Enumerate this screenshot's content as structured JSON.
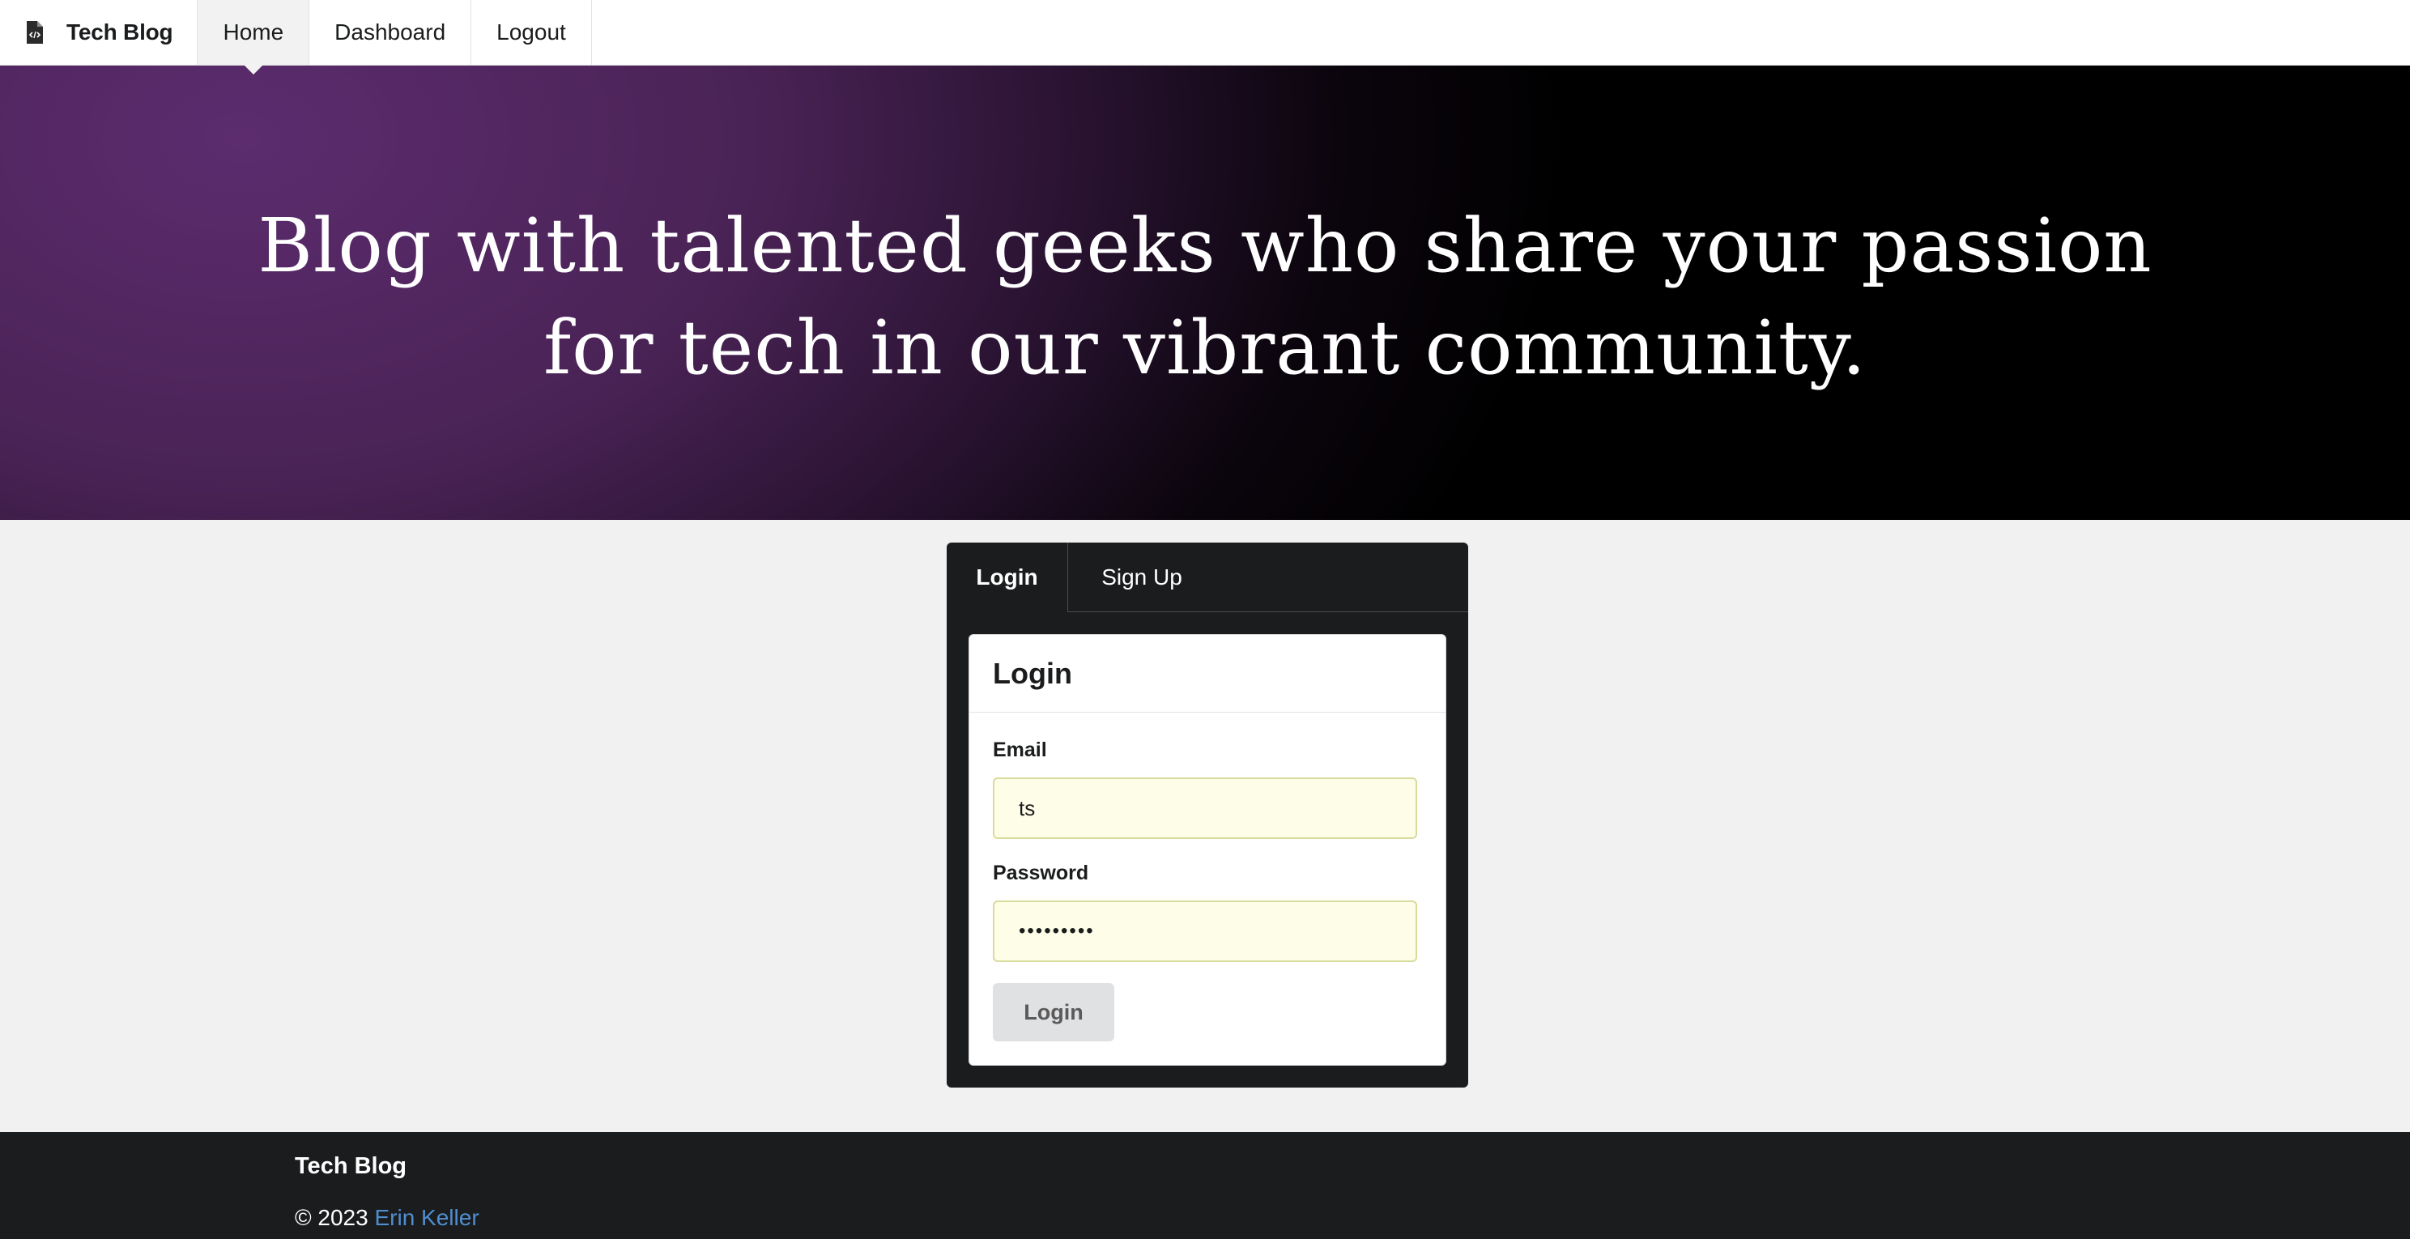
{
  "nav": {
    "brand": "Tech Blog",
    "brand_icon": "file-code-icon",
    "items": [
      {
        "label": "Home",
        "active": true
      },
      {
        "label": "Dashboard",
        "active": false
      },
      {
        "label": "Logout",
        "active": false
      }
    ]
  },
  "hero": {
    "line1": "Blog with talented geeks who share your passion",
    "line2": "for tech in our vibrant community."
  },
  "auth": {
    "tabs": [
      {
        "label": "Login",
        "active": true
      },
      {
        "label": "Sign Up",
        "active": false
      }
    ],
    "form_title": "Login",
    "email_label": "Email",
    "email_value": "ts",
    "password_label": "Password",
    "password_value": "•••••••••",
    "submit_label": "Login"
  },
  "footer": {
    "brand": "Tech Blog",
    "copyright": "© 2023",
    "author": "Erin Keller"
  },
  "colors": {
    "hero_purple": "#5c2c6e",
    "card_dark": "#1b1c1d",
    "input_bg": "#fefee8",
    "link_blue": "#4f8ed1"
  }
}
